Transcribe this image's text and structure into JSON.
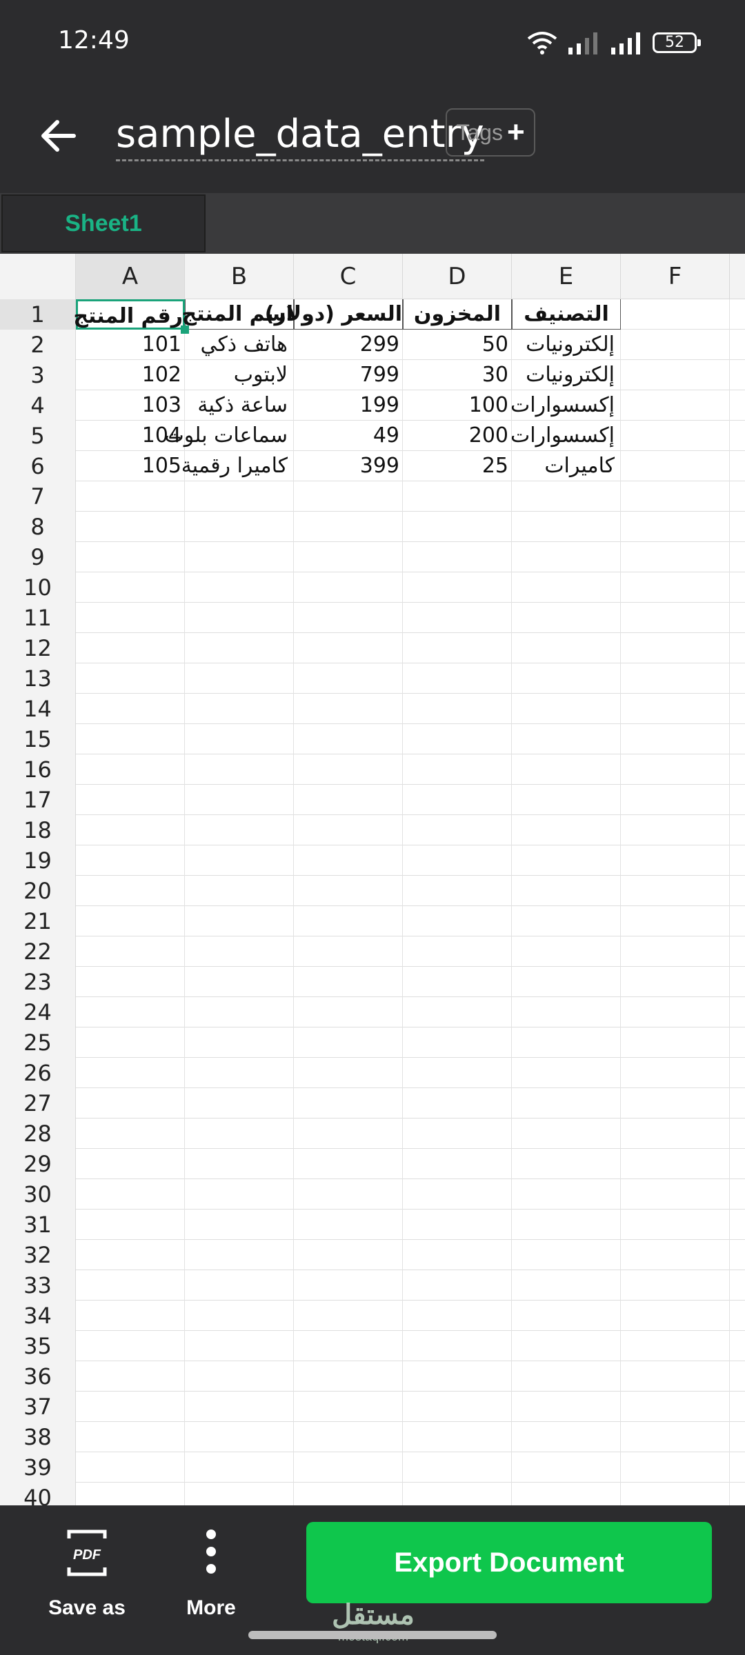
{
  "status_bar": {
    "time": "12:49",
    "battery": "52"
  },
  "header": {
    "title": "sample_data_entry",
    "tags_label": "Tags"
  },
  "sheets": [
    {
      "name": "Sheet1",
      "active": true
    }
  ],
  "grid": {
    "columns": [
      "A",
      "B",
      "C",
      "D",
      "E",
      "F"
    ],
    "active_column": "A",
    "active_row": "1",
    "row_numbers": [
      "1",
      "2",
      "3",
      "4",
      "5",
      "6",
      "7",
      "8",
      "9",
      "10",
      "11",
      "12",
      "13",
      "14",
      "15",
      "16",
      "17",
      "18",
      "19",
      "20",
      "21",
      "22",
      "23",
      "24",
      "25",
      "26",
      "27",
      "28",
      "29",
      "30",
      "31",
      "32",
      "33",
      "34",
      "35",
      "36",
      "37",
      "38",
      "39",
      "40"
    ],
    "header_row": [
      "رقم المنتج",
      "اسم المنتج",
      "السعر (دولار)",
      "المخزون",
      "التصنيف"
    ],
    "data_rows": [
      [
        "101",
        "هاتف ذكي",
        "299",
        "50",
        "إلكترونيات"
      ],
      [
        "102",
        "لابتوب",
        "799",
        "30",
        "إلكترونيات"
      ],
      [
        "103",
        "ساعة ذكية",
        "199",
        "100",
        "إكسسوارات"
      ],
      [
        "104",
        "سماعات بلوت",
        "49",
        "200",
        "إكسسوارات"
      ],
      [
        "105",
        "كاميرا رقمية",
        "399",
        "25",
        "كاميرات"
      ]
    ]
  },
  "bottom_bar": {
    "save_as_label": "Save as",
    "pdf_icon_text": "PDF",
    "more_label": "More",
    "export_label": "Export Document",
    "watermark_text": "مستقل",
    "watermark_sub": "mostaql.com",
    "accent_color": "#0fc64c"
  }
}
